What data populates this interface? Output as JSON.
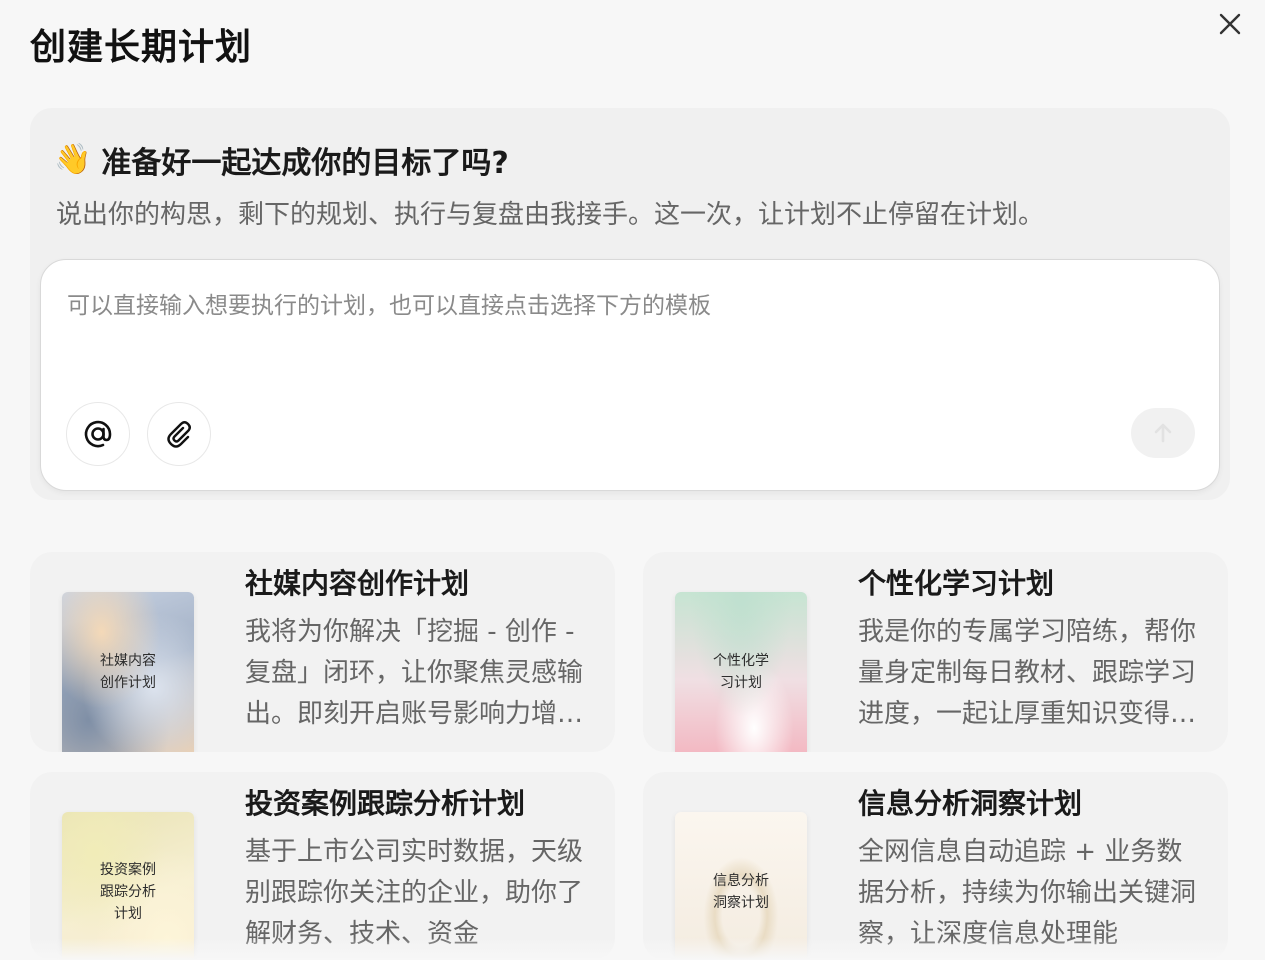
{
  "dialog": {
    "title": "创建长期计划"
  },
  "hero": {
    "emoji": "👋",
    "heading": "准备好一起达成你的目标了吗?",
    "subtitle": "说出你的构思，剩下的规划、执行与复盘由我接手。这一次，让计划不止停留在计划。"
  },
  "input": {
    "placeholder": "可以直接输入想要执行的计划，也可以直接点击选择下方的模板",
    "value": ""
  },
  "icons": {
    "close": "close-icon",
    "mention": "at-sign-icon",
    "attach": "paperclip-icon",
    "send": "arrow-up-icon"
  },
  "templates": [
    {
      "title": "社媒内容创作计划",
      "description": "我将为你解决「挖掘 - 创作 - 复盘」闭环，让你聚焦灵感输出。即刻开启账号影响力增长之旅",
      "cover_text": "社媒内容\n创作计划"
    },
    {
      "title": "个性化学习计划",
      "description": "我是你的专属学习陪练，帮你量身定制每日教材、跟踪学习进度，一起让厚重知识变得轻松",
      "cover_text": "个性化学\n习计划"
    },
    {
      "title": "投资案例跟踪分析计划",
      "description": "基于上市公司实时数据，天级别跟踪你关注的企业，助你了解财务、技术、资金",
      "cover_text": "投资案例\n跟踪分析\n计划"
    },
    {
      "title": "信息分析洞察计划",
      "description": "全网信息自动追踪 + 业务数据分析，持续为你输出关键洞察，让深度信息处理能",
      "cover_text": "信息分析\n洞察计划"
    }
  ]
}
